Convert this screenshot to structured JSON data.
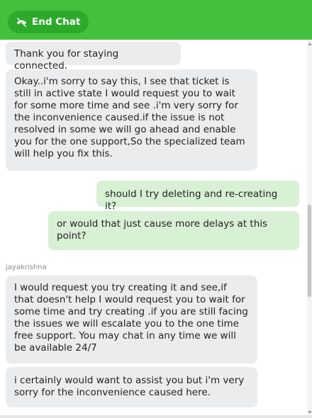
{
  "header": {
    "end_chat_label": "End Chat",
    "end_chat_icon": "phone-hangup-icon",
    "bg_color": "#44c03f"
  },
  "messages": [
    {
      "sender": "agent",
      "text": "Thank you for staying connected."
    },
    {
      "sender": "agent",
      "text": "Okay..i'm sorry to say this, I see that ticket is still in active state I would request you to wait for some more time and see .i'm very sorry for the inconvenience caused.if the issue is not resolved in some we will go ahead and enable you for the one support,So the specialized team will help you fix this."
    },
    {
      "sender": "user",
      "text": "should I try deleting and re-creating it?"
    },
    {
      "sender": "user",
      "text": "or would that just cause more delays at this point?"
    },
    {
      "sender": "agent_name",
      "text": "jayakrishna"
    },
    {
      "sender": "agent",
      "text": "I would request you try creating it and see,if that doesn't help I would request you to wait for some time and try creating .if you are still facing the issues we will escalate you to the one time free support. You may chat in any time we will be available 24/7"
    },
    {
      "sender": "agent",
      "text": "i certainly would want to assist you but i'm very sorry for the inconvenience caused here."
    }
  ],
  "colors": {
    "agent_bubble": "#ebecee",
    "user_bubble": "#d8f0d3"
  }
}
